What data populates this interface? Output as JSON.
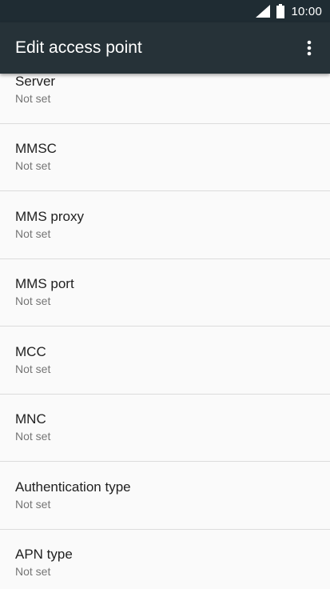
{
  "status_bar": {
    "time": "10:00",
    "icons": [
      "signal-icon",
      "battery-icon"
    ]
  },
  "app_bar": {
    "title": "Edit access point",
    "menu_icon": "overflow-menu-icon"
  },
  "settings": [
    {
      "label": "Server",
      "value": "Not set"
    },
    {
      "label": "MMSC",
      "value": "Not set"
    },
    {
      "label": "MMS proxy",
      "value": "Not set"
    },
    {
      "label": "MMS port",
      "value": "Not set"
    },
    {
      "label": "MCC",
      "value": "Not set"
    },
    {
      "label": "MNC",
      "value": "Not set"
    },
    {
      "label": "Authentication type",
      "value": "Not set"
    },
    {
      "label": "APN type",
      "value": "Not set"
    }
  ]
}
